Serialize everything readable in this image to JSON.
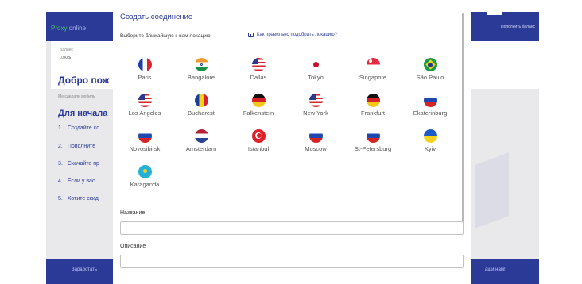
{
  "background": {
    "brand_name": "Proxy",
    "brand_suffix": "online",
    "topup_label": "Пополнить баланс",
    "balance_label": "Баланс",
    "balance_value": "0.00 $",
    "welcome_title": "Добро пож",
    "welcome_sub": "Ме сделали мобиль",
    "start_title": "Для начала",
    "steps": [
      {
        "num": "1.",
        "text": "Создайте со"
      },
      {
        "num": "2.",
        "text": "Пополните"
      },
      {
        "num": "3.",
        "text": "Скачайте пр"
      },
      {
        "num": "4.",
        "text": "Если у вас"
      },
      {
        "num": "5.",
        "text": "Хотите скид"
      }
    ],
    "footer_left": "Заработать",
    "footer_right": "аши нам!"
  },
  "modal": {
    "title": "Создать соединение",
    "prompt": "Выберите ближайшую к вам локацию",
    "help_link": "Как правильно подобрать локацию?",
    "locations": [
      {
        "label": "Paris",
        "flag": "fr"
      },
      {
        "label": "Bangalore",
        "flag": "in"
      },
      {
        "label": "Dallas",
        "flag": "us"
      },
      {
        "label": "Tokyo",
        "flag": "jp"
      },
      {
        "label": "Singapore",
        "flag": "sg"
      },
      {
        "label": "São Paulo",
        "flag": "br"
      },
      {
        "label": "Los Angeles",
        "flag": "us"
      },
      {
        "label": "Bucharest",
        "flag": "ro"
      },
      {
        "label": "Falkenstein",
        "flag": "de"
      },
      {
        "label": "New York",
        "flag": "us"
      },
      {
        "label": "Frankfurt",
        "flag": "de"
      },
      {
        "label": "Ekaterinburg",
        "flag": "ru"
      },
      {
        "label": "Novosibirsk",
        "flag": "ru"
      },
      {
        "label": "Amsterdam",
        "flag": "nl"
      },
      {
        "label": "Istanbul",
        "flag": "tr"
      },
      {
        "label": "Moscow",
        "flag": "ru"
      },
      {
        "label": "St-Petersburg",
        "flag": "ru"
      },
      {
        "label": "Kyiv",
        "flag": "ua"
      },
      {
        "label": "Karaganda",
        "flag": "kz"
      }
    ],
    "name_label": "Название",
    "name_value": "",
    "description_label": "Описание",
    "description_value": ""
  },
  "colors": {
    "primary": "#2b3a97",
    "accent_green": "#46c06a"
  }
}
